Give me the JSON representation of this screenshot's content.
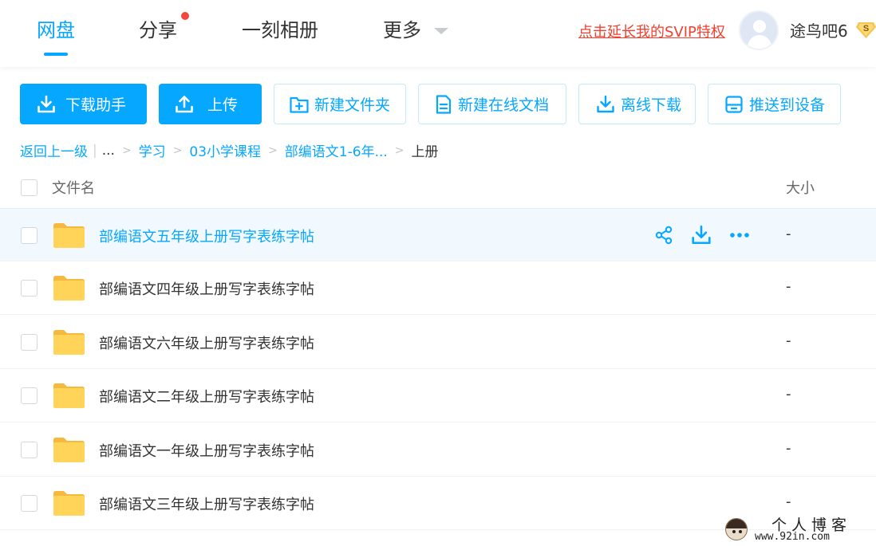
{
  "nav": {
    "tabs": [
      {
        "label": "网盘",
        "active": true
      },
      {
        "label": "分享",
        "has_dot": true
      },
      {
        "label": "一刻相册"
      },
      {
        "label": "更多",
        "has_dropdown": true
      }
    ],
    "svip_link": "点击延长我的SVIP特权",
    "username": "途鸟吧6",
    "vip_badge_letter": "S"
  },
  "toolbar": {
    "download_helper": "下载助手",
    "upload": "上传",
    "new_folder": "新建文件夹",
    "new_online_doc": "新建在线文档",
    "offline_download": "离线下载",
    "push_to_device": "推送到设备"
  },
  "breadcrumb": {
    "back": "返回上一级",
    "ellipsis": "...",
    "items": [
      "学习",
      "03小学课程",
      "部编语文1-6年..."
    ],
    "current": "上册"
  },
  "list": {
    "col_name": "文件名",
    "col_size": "大小",
    "rows": [
      {
        "name": "部编语文五年级上册写字表练字帖",
        "size": "-",
        "hover": true
      },
      {
        "name": "部编语文四年级上册写字表练字帖",
        "size": "-"
      },
      {
        "name": "部编语文六年级上册写字表练字帖",
        "size": "-"
      },
      {
        "name": "部编语文二年级上册写字表练字帖",
        "size": "-"
      },
      {
        "name": "部编语文一年级上册写字表练字帖",
        "size": "-"
      },
      {
        "name": "部编语文三年级上册写字表练字帖",
        "size": "-"
      }
    ]
  },
  "watermark": {
    "title": "个人博客",
    "url": "www.92in.com"
  },
  "colors": {
    "accent": "#06a7ff",
    "red": "#f0402f",
    "folder": "#ffd458",
    "row_hover": "#f2f9fe"
  }
}
